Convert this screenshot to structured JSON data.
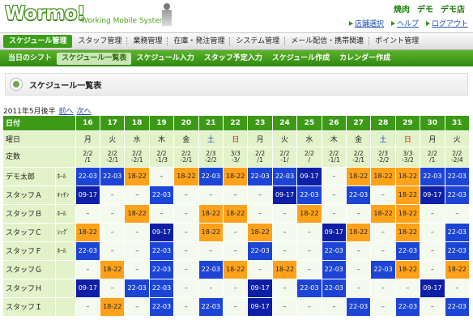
{
  "header": {
    "logo": "Wormo!",
    "subtitle": "Working Mobile System",
    "top_links": [
      "焼肉",
      "デモ",
      "デモ店"
    ],
    "user_links": [
      "店舗選択",
      "ヘルプ",
      "ログアウト"
    ]
  },
  "main_menu": [
    "スケジュール管理",
    "スタッフ管理",
    "業務管理",
    "在庫・発注管理",
    "システム管理",
    "メール配信・携帯関連",
    "ポイント管理"
  ],
  "sub_menu": [
    "当日のシフト",
    "スケジュール一覧表",
    "スケジュール入力",
    "スタッフ予定入力",
    "スケジュール作成",
    "カレンダー作成"
  ],
  "page_title": "スケジュール一覧表",
  "period": {
    "label": "2011年5月後半",
    "prev": "前へ",
    "next": "次へ"
  },
  "table": {
    "label_day": "日付",
    "label_dow": "曜日",
    "label_quota": "定数",
    "days": [
      "16",
      "17",
      "18",
      "19",
      "20",
      "21",
      "22",
      "23",
      "24",
      "25",
      "26",
      "27",
      "28",
      "29",
      "30",
      "31"
    ],
    "dow": [
      "月",
      "火",
      "水",
      "木",
      "金",
      "土",
      "日",
      "月",
      "火",
      "水",
      "木",
      "金",
      "土",
      "日",
      "月",
      "火"
    ],
    "quota": [
      "2/2\n/1",
      "2/2\n-2/1",
      "2/2\n-2/1",
      "2/2\n-1/3",
      "2/2\n-2/1",
      "2/3\n-2/2",
      "3/3\n-3/",
      "2/2\n/1",
      "2/2\n-1/",
      "2/2\n/",
      "2/2\n-1/1",
      "2/2\n-2/1",
      "2/3\n-2/2",
      "3/3\n-3/2",
      "2/2\n/1",
      "2/2\n-2/4"
    ],
    "colors": {
      "orange": "#ffa21a",
      "blue": "#1c45d6",
      "darkblue": "#0c1fa6",
      "none": "#f4faee",
      "header": "#3c9a16"
    },
    "staff": [
      {
        "name": "デモ太郎",
        "role": "ﾎｰﾙ",
        "shifts": [
          [
            "22-03",
            "blue"
          ],
          [
            "22-03",
            "blue"
          ],
          [
            "18-22",
            "orange"
          ],
          [
            "–",
            "none"
          ],
          [
            "18-22",
            "orange"
          ],
          [
            "22-03",
            "blue"
          ],
          [
            "18-22",
            "orange"
          ],
          [
            "22-03",
            "blue"
          ],
          [
            "22-03",
            "blue"
          ],
          [
            "09-17",
            "darkblue"
          ],
          [
            "–",
            "none"
          ],
          [
            "18-22",
            "orange"
          ],
          [
            "18-22",
            "orange"
          ],
          [
            "18-22",
            "orange"
          ],
          [
            "22-03",
            "blue"
          ],
          [
            "22-03",
            "blue"
          ]
        ]
      },
      {
        "name": "スタッフＡ",
        "role": "ｷｯﾁﾝ",
        "shifts": [
          [
            "09-17",
            "darkblue"
          ],
          [
            "–",
            "none"
          ],
          [
            "–",
            "none"
          ],
          [
            "22-03",
            "blue"
          ],
          [
            "–",
            "none"
          ],
          [
            "–",
            "none"
          ],
          [
            "–",
            "none"
          ],
          [
            "–",
            "none"
          ],
          [
            "09-17",
            "darkblue"
          ],
          [
            "22-03",
            "blue"
          ],
          [
            "–",
            "none"
          ],
          [
            "22-03",
            "blue"
          ],
          [
            "–",
            "none"
          ],
          [
            "18-22",
            "orange"
          ],
          [
            "09-17",
            "darkblue"
          ],
          [
            "22-03",
            "blue"
          ]
        ]
      },
      {
        "name": "スタッフＢ",
        "role": "ﾎｰﾙ",
        "shifts": [
          [
            "–",
            "none"
          ],
          [
            "–",
            "none"
          ],
          [
            "18-22",
            "orange"
          ],
          [
            "–",
            "none"
          ],
          [
            "–",
            "none"
          ],
          [
            "18-22",
            "orange"
          ],
          [
            "18-22",
            "orange"
          ],
          [
            "–",
            "none"
          ],
          [
            "–",
            "none"
          ],
          [
            "18-22",
            "orange"
          ],
          [
            "–",
            "none"
          ],
          [
            "–",
            "none"
          ],
          [
            "18-22",
            "orange"
          ],
          [
            "18-22",
            "orange"
          ],
          [
            "–",
            "none"
          ],
          [
            "–",
            "none"
          ]
        ]
      },
      {
        "name": "スタッフＣ",
        "role": "ｼｯｸﾞ",
        "shifts": [
          [
            "18-22",
            "orange"
          ],
          [
            "–",
            "none"
          ],
          [
            "–",
            "none"
          ],
          [
            "09-17",
            "darkblue"
          ],
          [
            "–",
            "none"
          ],
          [
            "18-22",
            "orange"
          ],
          [
            "–",
            "none"
          ],
          [
            "18-22",
            "orange"
          ],
          [
            "–",
            "none"
          ],
          [
            "–",
            "none"
          ],
          [
            "09-17",
            "darkblue"
          ],
          [
            "18-22",
            "orange"
          ],
          [
            "–",
            "none"
          ],
          [
            "18-22",
            "orange"
          ],
          [
            "–",
            "none"
          ],
          [
            "22-03",
            "blue"
          ]
        ]
      },
      {
        "name": "スタッフＦ",
        "role": "ﾎｰﾙ",
        "shifts": [
          [
            "22-03",
            "blue"
          ],
          [
            "–",
            "none"
          ],
          [
            "–",
            "none"
          ],
          [
            "22-03",
            "blue"
          ],
          [
            "–",
            "none"
          ],
          [
            "–",
            "none"
          ],
          [
            "–",
            "none"
          ],
          [
            "22-03",
            "blue"
          ],
          [
            "–",
            "none"
          ],
          [
            "–",
            "none"
          ],
          [
            "22-03",
            "blue"
          ],
          [
            "–",
            "none"
          ],
          [
            "–",
            "none"
          ],
          [
            "22-03",
            "blue"
          ],
          [
            "–",
            "none"
          ],
          [
            "22-03",
            "blue"
          ]
        ]
      },
      {
        "name": "スタッフＧ",
        "role": "",
        "shifts": [
          [
            "–",
            "none"
          ],
          [
            "18-22",
            "orange"
          ],
          [
            "–",
            "none"
          ],
          [
            "22-03",
            "blue"
          ],
          [
            "–",
            "none"
          ],
          [
            "22-03",
            "blue"
          ],
          [
            "18-22",
            "orange"
          ],
          [
            "–",
            "none"
          ],
          [
            "18-22",
            "orange"
          ],
          [
            "–",
            "none"
          ],
          [
            "22-03",
            "blue"
          ],
          [
            "–",
            "none"
          ],
          [
            "22-03",
            "blue"
          ],
          [
            "18-22",
            "orange"
          ],
          [
            "–",
            "none"
          ],
          [
            "18-22",
            "orange"
          ]
        ]
      },
      {
        "name": "スタッフＨ",
        "role": "",
        "shifts": [
          [
            "09-17",
            "darkblue"
          ],
          [
            "–",
            "none"
          ],
          [
            "22-03",
            "blue"
          ],
          [
            "22-03",
            "blue"
          ],
          [
            "–",
            "none"
          ],
          [
            "–",
            "none"
          ],
          [
            "–",
            "none"
          ],
          [
            "09-17",
            "darkblue"
          ],
          [
            "–",
            "none"
          ],
          [
            "22-03",
            "blue"
          ],
          [
            "22-03",
            "blue"
          ],
          [
            "–",
            "none"
          ],
          [
            "–",
            "none"
          ],
          [
            "–",
            "none"
          ],
          [
            "09-17",
            "darkblue"
          ],
          [
            "–",
            "none"
          ]
        ]
      },
      {
        "name": "スタッフＩ",
        "role": "",
        "shifts": [
          [
            "–",
            "none"
          ],
          [
            "18-22",
            "orange"
          ],
          [
            "–",
            "none"
          ],
          [
            "22-03",
            "blue"
          ],
          [
            "–",
            "none"
          ],
          [
            "22-03",
            "blue"
          ],
          [
            "–",
            "none"
          ],
          [
            "09-17",
            "darkblue"
          ],
          [
            "–",
            "none"
          ],
          [
            "–",
            "none"
          ],
          [
            "–",
            "none"
          ],
          [
            "22-03",
            "blue"
          ],
          [
            "–",
            "none"
          ],
          [
            "22-03",
            "blue"
          ],
          [
            "–",
            "none"
          ],
          [
            "22-03",
            "blue"
          ]
        ]
      }
    ]
  }
}
